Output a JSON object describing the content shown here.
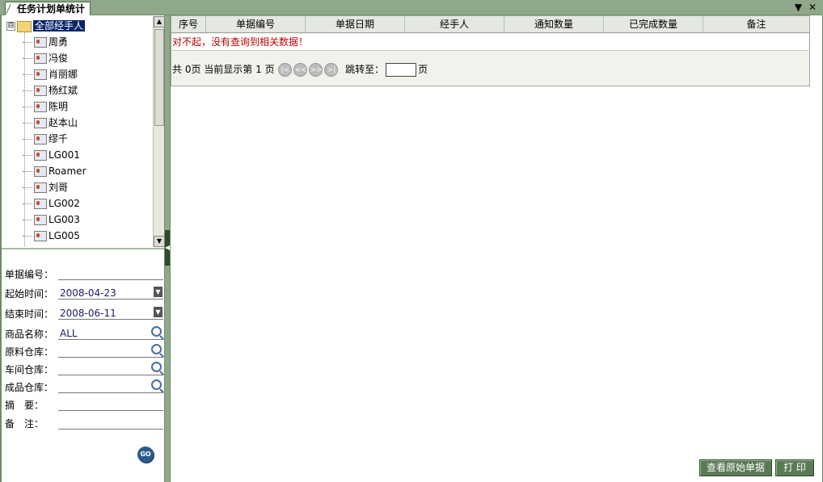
{
  "window": {
    "tab_title": "任务计划单统计",
    "menu_glyph": "▼",
    "close_glyph": "✕"
  },
  "tree": {
    "root_label": "全部经手人",
    "expander": "⊟",
    "items": [
      "周勇",
      "冯俊",
      "肖丽娜",
      "杨红斌",
      "陈明",
      "赵本山",
      "缪千",
      "LG001",
      "Roamer",
      "刘哥",
      "LG002",
      "LG003",
      "LG005"
    ]
  },
  "scrollbar": {
    "up": "▲",
    "down": "▼"
  },
  "form": {
    "doc_no_label": "单据编号：",
    "doc_no_value": "",
    "start_label": "起始时间：",
    "start_value": "2008-04-23",
    "end_label": "结束时间：",
    "end_value": "2008-06-11",
    "product_label": "商品名称：",
    "product_value": "ALL",
    "raw_wh_label": "原料仓库：",
    "raw_wh_value": "",
    "shop_wh_label": "车间仓库：",
    "shop_wh_value": "",
    "finish_wh_label": "成品仓库：",
    "finish_wh_value": "",
    "summary_label": "摘　要：",
    "summary_value": "",
    "remark_label": "备　注：",
    "remark_value": "",
    "go_label": "GO",
    "dd_glyph": "▼"
  },
  "splitter": {
    "glyph": "◀"
  },
  "grid": {
    "columns": [
      "序号",
      "单据编号",
      "单据日期",
      "经手人",
      "通知数量",
      "已完成数量",
      "备注"
    ],
    "message": "对不起，没有查询到相关数据！"
  },
  "pager": {
    "total_prefix": "共",
    "total_pages": "0",
    "pages_mid": "页 当前显示第",
    "current_page": "1",
    "pages_suffix": "页",
    "first": "|<",
    "prev": "<<",
    "next": ">>",
    "last": ">|",
    "jump_label": "跳转至：",
    "jump_suffix": "页"
  },
  "buttons": {
    "view_original": "查看原始单据",
    "print": "打 印"
  }
}
